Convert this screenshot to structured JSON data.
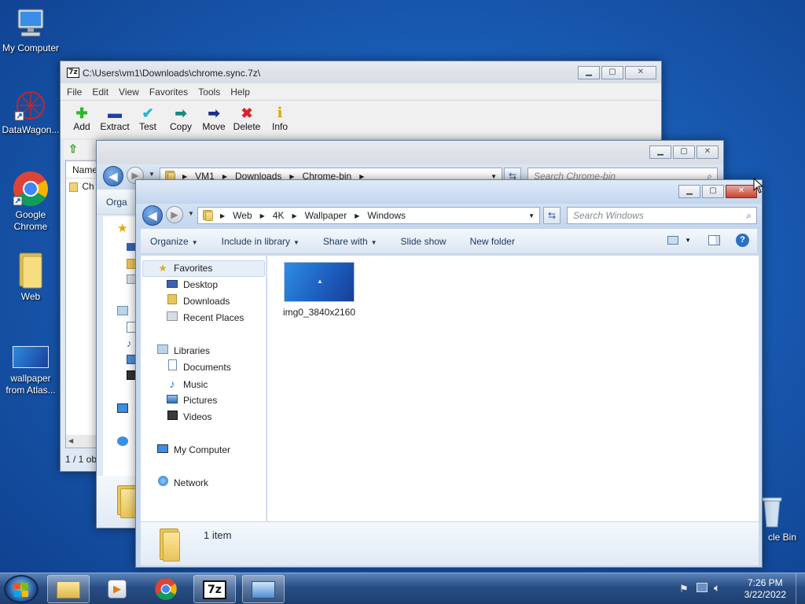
{
  "desktop": {
    "icons": [
      {
        "label": "My Computer",
        "icon": "computer-icon"
      },
      {
        "label": "DataWagon...",
        "icon": "datawagon-icon"
      },
      {
        "label": "Google Chrome",
        "icon": "chrome-icon"
      },
      {
        "label": "Web",
        "icon": "folder-icon"
      },
      {
        "label": "wallpaper from Atlas...",
        "icon": "wallpaper-icon"
      },
      {
        "label": "cle Bin",
        "icon": "recycle-bin-icon"
      }
    ]
  },
  "zip_window": {
    "title": "C:\\Users\\vm1\\Downloads\\chrome.sync.7z\\",
    "menu": [
      "File",
      "Edit",
      "View",
      "Favorites",
      "Tools",
      "Help"
    ],
    "toolbar": [
      "Add",
      "Extract",
      "Test",
      "Copy",
      "Move",
      "Delete",
      "Info"
    ],
    "column_header": "Name",
    "row_partial": "Ch",
    "status": "1 / 1 ob"
  },
  "explorer_back": {
    "path": [
      "VM1",
      "Downloads",
      "Chrome-bin"
    ],
    "search_placeholder": "Search Chrome-bin",
    "cmd_partial": "Orga"
  },
  "explorer_front": {
    "path": [
      "Web",
      "4K",
      "Wallpaper",
      "Windows"
    ],
    "search_placeholder": "Search Windows",
    "commands": [
      "Organize",
      "Include in library",
      "Share with",
      "Slide show",
      "New folder"
    ],
    "nav": {
      "favorites": "Favorites",
      "favorites_items": [
        "Desktop",
        "Downloads",
        "Recent Places"
      ],
      "libraries": "Libraries",
      "libraries_items": [
        "Documents",
        "Music",
        "Pictures",
        "Videos"
      ],
      "computer": "My Computer",
      "network": "Network"
    },
    "file": {
      "name": "img0_3840x2160"
    },
    "details": "1 item"
  },
  "taskbar": {
    "time": "7:26 PM",
    "date": "3/22/2022"
  }
}
